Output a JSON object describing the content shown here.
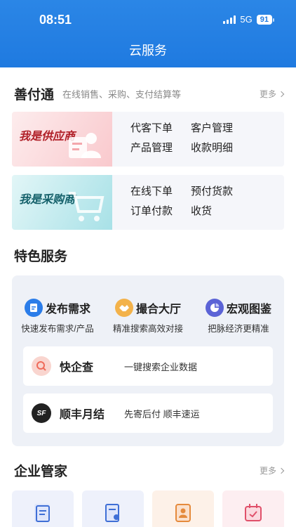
{
  "status_bar": {
    "time": "08:51",
    "network": "5G",
    "battery": "91"
  },
  "header": {
    "title": "云服务"
  },
  "shanfutong": {
    "title": "善付通",
    "subtitle": "在线销售、采购、支付结算等",
    "more": "更多",
    "supplier": {
      "banner": "我是供应商",
      "links": [
        "代客下单",
        "客户管理",
        "产品管理",
        "收款明细"
      ]
    },
    "buyer": {
      "banner": "我是采购商",
      "links": [
        "在线下单",
        "预付货款",
        "订单付款",
        "收货"
      ]
    }
  },
  "features": {
    "title": "特色服务",
    "columns": [
      {
        "title": "发布需求",
        "desc": "快速发布需求/产品",
        "icon": "document-icon",
        "color": "#2b7de9"
      },
      {
        "title": "撮合大厅",
        "desc": "精准搜索高效对接",
        "icon": "handshake-icon",
        "color": "#f0a030"
      },
      {
        "title": "宏观图鉴",
        "desc": "把脉经济更精准",
        "icon": "chart-icon",
        "color": "#5b63d6"
      }
    ],
    "cards": [
      {
        "title": "快企查",
        "desc": "一键搜索企业数据",
        "icon": "search-company-icon",
        "color": "#ef6b5a"
      },
      {
        "title": "顺丰月结",
        "desc": "先寄后付  顺丰速运",
        "icon": "sf-express-icon",
        "badge": "SF",
        "color": "#222222"
      }
    ]
  },
  "butler": {
    "title": "企业管家",
    "more": "更多",
    "tiles": [
      {
        "icon": "file-icon",
        "color": "#3f6fd6"
      },
      {
        "icon": "certificate-icon",
        "color": "#3f6fd6"
      },
      {
        "icon": "contacts-icon",
        "color": "#e58a3c"
      },
      {
        "icon": "calendar-icon",
        "color": "#e0506a"
      }
    ]
  }
}
